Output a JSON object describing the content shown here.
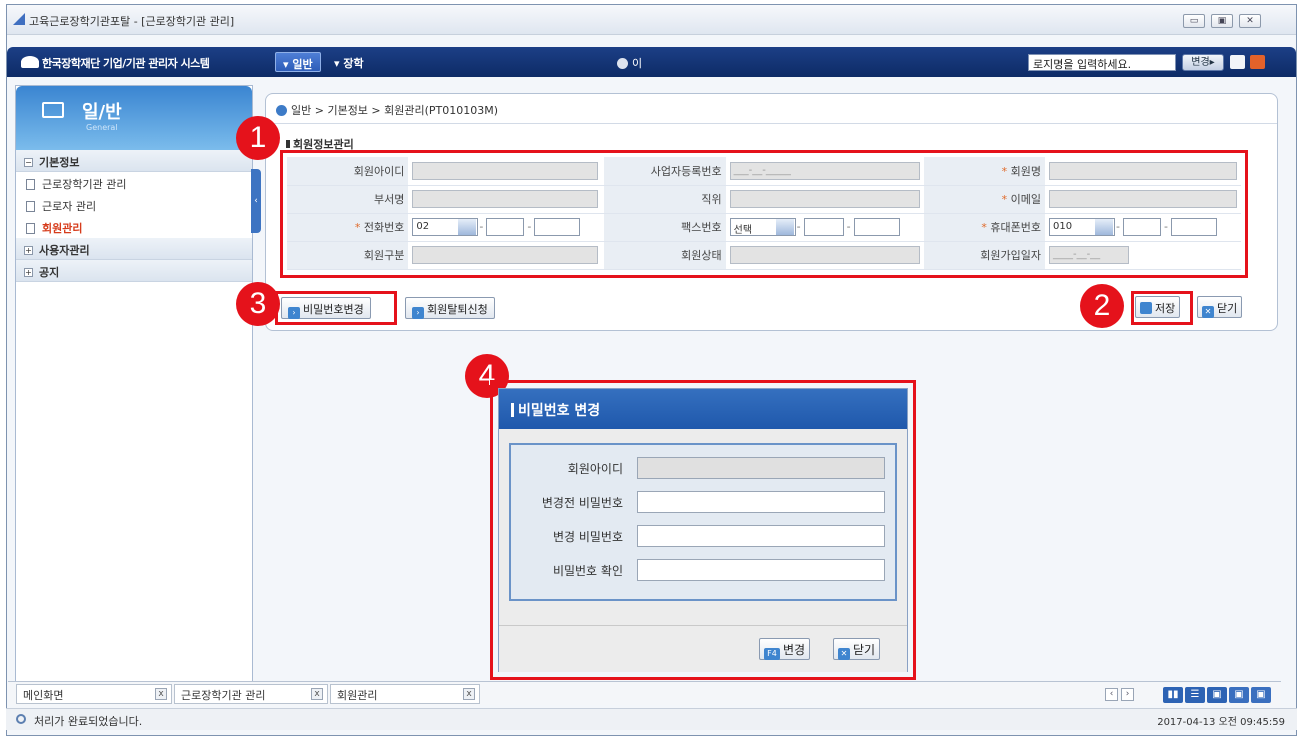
{
  "window": {
    "title": "고육근로장학기관포탈 - [근로장학기관 관리]"
  },
  "topnav": {
    "logo": "한국장학재단 기업/기관 관리자 시스템",
    "tabs": [
      {
        "label": "▾ 일반"
      },
      {
        "label": "▾ 장학"
      }
    ],
    "user": "이",
    "search_value": "로지명을 입력하세요.",
    "change_btn": "변경▸"
  },
  "sidebar": {
    "title": "일/반",
    "subtitle": "General",
    "groups": [
      {
        "label": "기본정보",
        "sign": "−"
      },
      {
        "label": "사용자관리",
        "sign": "+"
      },
      {
        "label": "공지",
        "sign": "+"
      }
    ],
    "items": [
      {
        "label": "근로장학기관 관리"
      },
      {
        "label": "근로자 관리"
      },
      {
        "label": "회원관리"
      }
    ]
  },
  "breadcrumb": "일반 > 기본정보 > 회원관리(PT010103M)",
  "section_title": "회원정보관리",
  "form": {
    "member_id": "회원아이디",
    "bizno": "사업자등록번호",
    "bizno_value": "___-__-_____",
    "name": "회원명",
    "dept": "부서명",
    "position": "직위",
    "email": "이메일",
    "phone": "전화번호",
    "phone_prefix": "02",
    "fax": "팩스번호",
    "fax_prefix": "선택",
    "mobile": "휴대폰번호",
    "mobile_prefix": "010",
    "member_type": "회원구분",
    "member_status": "회원상태",
    "join_date": "회원가입일자",
    "join_date_value": "____-__-__"
  },
  "buttons": {
    "change_pw": "비밀번호변경",
    "withdraw": "회원탈퇴신청",
    "save": "저장",
    "close": "닫기"
  },
  "badges": [
    "1",
    "2",
    "3",
    "4"
  ],
  "popup": {
    "title": "비밀번호 변경",
    "labels": [
      "회원아이디",
      "변경전 비밀번호",
      "변경 비밀번호",
      "비밀번호 확인"
    ],
    "change_btn": "변경",
    "change_key": "F4",
    "close_btn": "닫기"
  },
  "taskbar": {
    "tabs": [
      "메인화면",
      "근로장학기관 관리",
      "회원관리"
    ]
  },
  "status": {
    "text": "처리가 완료되었습니다.",
    "datetime": "2017-04-13 오전 09:45:59"
  }
}
